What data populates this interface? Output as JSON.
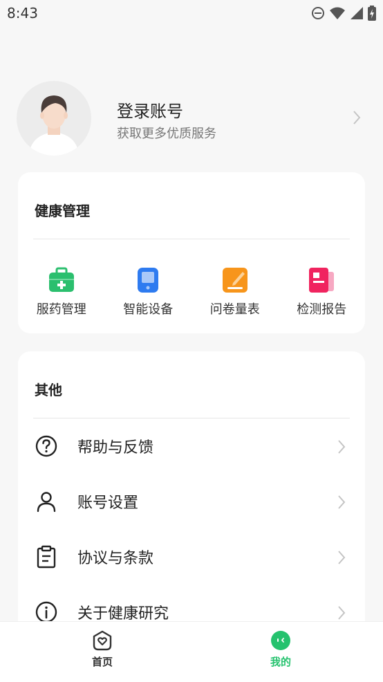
{
  "status_bar": {
    "time": "8:43"
  },
  "profile": {
    "title": "登录账号",
    "subtitle": "获取更多优质服务"
  },
  "health": {
    "title": "健康管理",
    "items": [
      {
        "label": "服药管理",
        "icon": "medicine-kit-icon",
        "color": "#2bbf6e"
      },
      {
        "label": "智能设备",
        "icon": "smart-device-icon",
        "color": "#2e7bf0"
      },
      {
        "label": "问卷量表",
        "icon": "questionnaire-icon",
        "color": "#f7951b"
      },
      {
        "label": "检测报告",
        "icon": "report-icon",
        "color": "#f0245f"
      }
    ]
  },
  "other": {
    "title": "其他",
    "items": [
      {
        "label": "帮助与反馈",
        "icon": "help-icon"
      },
      {
        "label": "账号设置",
        "icon": "person-icon"
      },
      {
        "label": "协议与条款",
        "icon": "clipboard-icon"
      },
      {
        "label": "关于健康研究",
        "icon": "info-icon"
      }
    ]
  },
  "tabs": [
    {
      "label": "首页",
      "icon": "home-heart-icon",
      "active": false,
      "color": "#333333"
    },
    {
      "label": "我的",
      "icon": "mine-face-icon",
      "active": true,
      "color": "#25c26e"
    }
  ]
}
